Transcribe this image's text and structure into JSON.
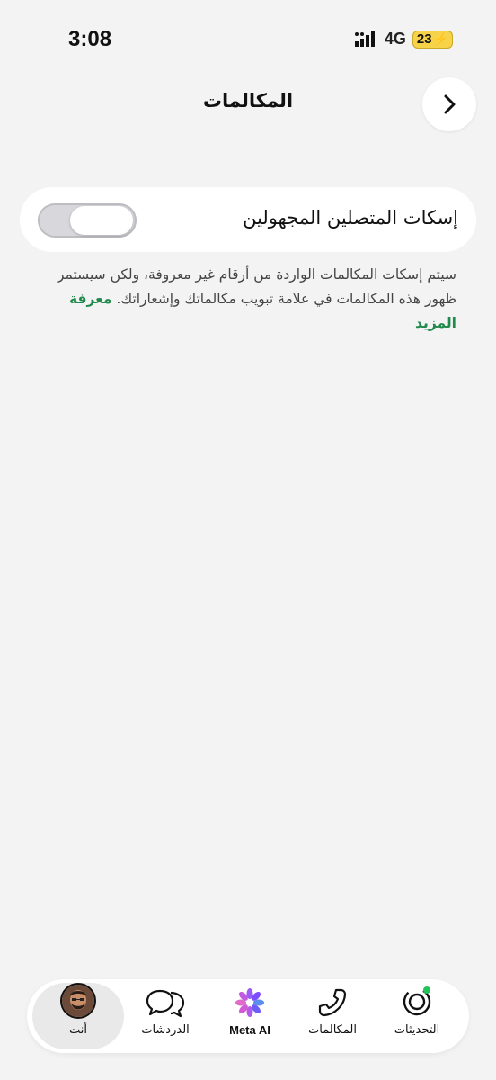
{
  "status_bar": {
    "time": "3:08",
    "network": "4G",
    "battery": "23"
  },
  "header": {
    "title": "المكالمات",
    "back_icon": "chevron-right-icon"
  },
  "setting": {
    "label": "إسكات المتصلين المجهولين",
    "toggle_state": "off"
  },
  "description": {
    "text": "سيتم إسكات المكالمات الواردة من أرقام غير معروفة، ولكن سيستمر ظهور هذه المكالمات في علامة تبويب مكالماتك وإشعاراتك.",
    "link": "معرفة المزيد"
  },
  "tabs": [
    {
      "label": "التحديثات",
      "icon": "updates-icon"
    },
    {
      "label": "المكالمات",
      "icon": "phone-icon"
    },
    {
      "label": "Meta AI",
      "icon": "meta-ai-icon"
    },
    {
      "label": "الدردشات",
      "icon": "chats-icon"
    },
    {
      "label": "أنت",
      "icon": "avatar",
      "active": true
    }
  ],
  "colors": {
    "background": "#f3f3f3",
    "accent_green": "#1f8a4c",
    "battery": "#f7d34a"
  }
}
